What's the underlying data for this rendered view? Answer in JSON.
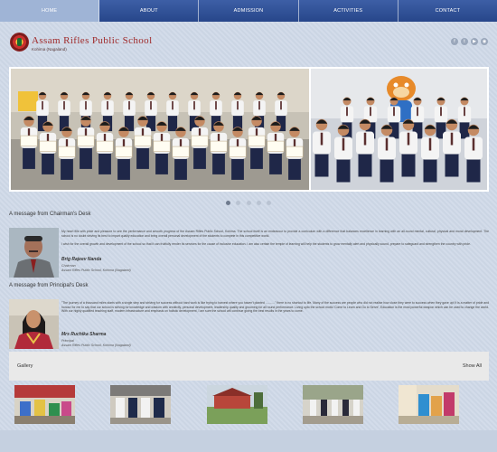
{
  "nav": {
    "items": [
      {
        "label": "HOME",
        "active": true
      },
      {
        "label": "ABOUT",
        "active": false
      },
      {
        "label": "ADMISSION",
        "active": false
      },
      {
        "label": "ACTIVITIES",
        "active": false
      },
      {
        "label": "CONTACT",
        "active": false
      }
    ]
  },
  "header": {
    "title": "Assam Rifles Public School",
    "subtitle": "Kohima (Nagaland)",
    "socials": [
      "facebook-icon",
      "twitter-icon",
      "youtube-icon",
      "rss-icon"
    ]
  },
  "slider": {
    "dots": 5,
    "active_dot": 0
  },
  "chairman": {
    "heading": "A message from Chairman's Desk",
    "para1": "My heart fills with pride and pleasure to see the performance and smooth progress of the Assam Rifles Public School, Kohima. The school itself is an endeavour to provide a curriculum with a difference that balances excellence in learning with an all-round mental, cultural, physical and moral development. The school is no doubt striving its best to impart quality education and bring overall personal development of the students to compete in this competitive world.",
    "para2": "I wish for the overall growth and development of the school so that it can fruitfully render its services for the cause of inclusive education. I am also certain the temple of learning will help the students to grow mentally alert and physically sound, prepare to safeguard and strengthen the country with pride.",
    "name": "Brig Rajeev Nanda",
    "role": "Chairman",
    "org": "Assam Rifles Public School, Kohima (Nagaland)"
  },
  "principal": {
    "heading": "A message from Principal's Desk",
    "para1": "\"The journey of a thousand miles starts with a single step and striving for success without hard work is like trying to harvest where you haven't planted ...........\" there is no shortcut to life. Many of the success are people who did not realise how close they were to success when they gave up! It is a matter of pride and honour for me to say that our school is striving for knowledge and wisdom with creativity, personal development, leadership quality and grooming for all round performance. Living upto the school motto 'Come to Learn and Go to Serve', Education is the most powerful weapon which can be used to change the world. With our highly qualified teaching staff, modern infrastructure and emphasis on holistic development, I am sure the school will continue giving the best results in the years to come.",
    "name": "Mrs Ruchika Sharma",
    "role": "Principal",
    "org": "Assam Rifles Public School, Kohima (Nagaland)"
  },
  "gallery": {
    "title": "Gallery",
    "show_all": "Show All",
    "thumbs": [
      "gallery-photo-1",
      "gallery-photo-2",
      "gallery-photo-3",
      "gallery-photo-4",
      "gallery-photo-5"
    ]
  },
  "colors": {
    "nav": "#2f4f93",
    "nav_active": "#9fb4d6",
    "title": "#a02a2a",
    "background": "#cfd9e8"
  }
}
